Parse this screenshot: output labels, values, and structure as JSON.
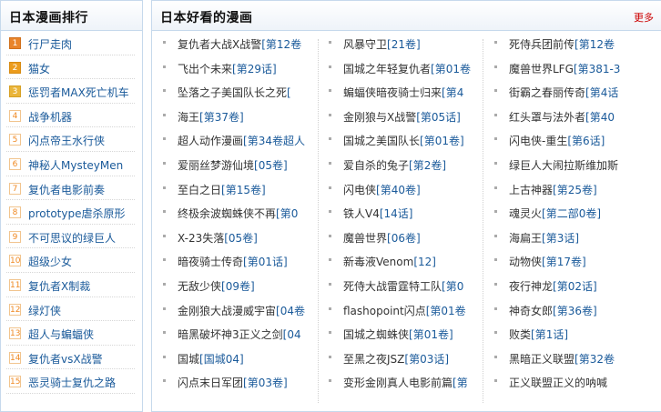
{
  "left": {
    "title": "日本漫画排行",
    "items": [
      {
        "n": "1",
        "label": "行尸走肉"
      },
      {
        "n": "2",
        "label": "猫女"
      },
      {
        "n": "3",
        "label": "惩罚者MAX死亡机车"
      },
      {
        "n": "4",
        "label": "战争机器"
      },
      {
        "n": "5",
        "label": "闪点帝王水行侠"
      },
      {
        "n": "6",
        "label": "神秘人MysteyMen"
      },
      {
        "n": "7",
        "label": "复仇者电影前奏"
      },
      {
        "n": "8",
        "label": "prototype虐杀原形"
      },
      {
        "n": "9",
        "label": "不可思议的绿巨人"
      },
      {
        "n": "10",
        "label": "超级少女"
      },
      {
        "n": "11",
        "label": "复仇者X制裁"
      },
      {
        "n": "12",
        "label": "绿灯侠"
      },
      {
        "n": "13",
        "label": "超人与蝙蝠侠"
      },
      {
        "n": "14",
        "label": "复仇者vsX战警"
      },
      {
        "n": "15",
        "label": "恶灵骑士复仇之路"
      }
    ]
  },
  "right": {
    "title": "日本好看的漫画",
    "more": "更多",
    "columns": [
      [
        {
          "name": "复仇者大战X战警",
          "vol": "[第12卷"
        },
        {
          "name": "飞出个未来",
          "vol": "[第29话]"
        },
        {
          "name": "坠落之子美国队长之死",
          "vol": "["
        },
        {
          "name": "海王",
          "vol": "[第37卷]"
        },
        {
          "name": "超人动作漫画",
          "vol": "[第34卷超人"
        },
        {
          "name": "爱丽丝梦游仙境",
          "vol": "[05卷]"
        },
        {
          "name": "至白之日",
          "vol": "[第15卷]"
        },
        {
          "name": "终极余波蜘蛛侠不再",
          "vol": "[第0"
        },
        {
          "name": "X-23失落",
          "vol": "[05卷]"
        },
        {
          "name": "暗夜骑士传奇",
          "vol": "[第01话]"
        },
        {
          "name": "无敌少侠",
          "vol": "[09卷]"
        },
        {
          "name": "金刚狼大战漫威宇宙",
          "vol": "[04卷"
        },
        {
          "name": "暗黑破坏神3正义之剑",
          "vol": "[04"
        },
        {
          "name": "国城",
          "vol": "[国城04]"
        },
        {
          "name": "闪点末日军团",
          "vol": "[第03卷]"
        }
      ],
      [
        {
          "name": "风暴守卫",
          "vol": "[21卷]"
        },
        {
          "name": "国城之年轻复仇者",
          "vol": "[第01卷"
        },
        {
          "name": "蝙蝠侠暗夜骑士归来",
          "vol": "[第4"
        },
        {
          "name": "金刚狼与X战警",
          "vol": "[第05话]"
        },
        {
          "name": "国城之美国队长",
          "vol": "[第01卷]"
        },
        {
          "name": "爱自杀的兔子",
          "vol": "[第2卷]"
        },
        {
          "name": "闪电侠",
          "vol": "[第40卷]"
        },
        {
          "name": "铁人V4",
          "vol": "[14话]"
        },
        {
          "name": "魔兽世界",
          "vol": "[06卷]"
        },
        {
          "name": "新毒液Venom",
          "vol": "[12]"
        },
        {
          "name": "死侍大战雷霆特工队",
          "vol": "[第0"
        },
        {
          "name": "flashopoint闪点",
          "vol": "[第01卷"
        },
        {
          "name": "国城之蜘蛛侠",
          "vol": "[第01卷]"
        },
        {
          "name": "至黑之夜JSZ",
          "vol": "[第03话]"
        },
        {
          "name": "变形金刚真人电影前篇",
          "vol": "[第"
        }
      ],
      [
        {
          "name": "死侍兵团前传",
          "vol": "[第12卷"
        },
        {
          "name": "魔兽世界LFG",
          "vol": "[第381-3"
        },
        {
          "name": "街霸之春丽传奇",
          "vol": "[第4话"
        },
        {
          "name": "红头罩与法外者",
          "vol": "[第40"
        },
        {
          "name": "闪电侠-重生",
          "vol": "[第6话]"
        },
        {
          "name": "绿巨人大闹拉斯维加斯",
          "vol": ""
        },
        {
          "name": "上古神器",
          "vol": "[第25卷]"
        },
        {
          "name": "魂灵火",
          "vol": "[第二部0卷]"
        },
        {
          "name": "海扁王",
          "vol": "[第3话]"
        },
        {
          "name": "动物侠",
          "vol": "[第17卷]"
        },
        {
          "name": "夜行神龙",
          "vol": "[第02话]"
        },
        {
          "name": "神奇女郎",
          "vol": "[第36卷]"
        },
        {
          "name": "败类",
          "vol": "[第1话]"
        },
        {
          "name": "黑暗正义联盟",
          "vol": "[第32卷"
        },
        {
          "name": "正义联盟正义的呐喊",
          "vol": ""
        }
      ]
    ]
  }
}
